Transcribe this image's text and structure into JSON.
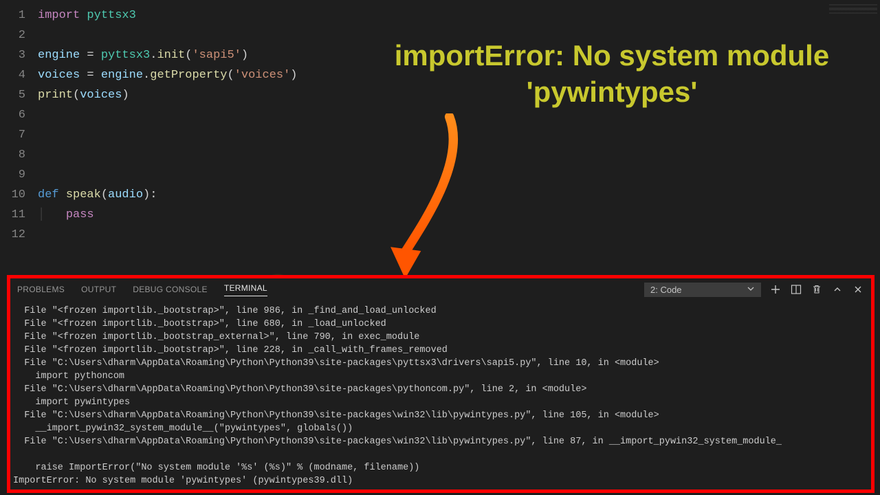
{
  "code": {
    "lines": [
      {
        "n": "1",
        "html": "<span class='kw'>import</span> <span class='mod'>pyttsx3</span>"
      },
      {
        "n": "2",
        "html": ""
      },
      {
        "n": "3",
        "html": "<span class='var'>engine</span> = <span class='mod'>pyttsx3</span>.<span class='fn'>init</span>(<span class='str'>'sapi5'</span>)"
      },
      {
        "n": "4",
        "html": "<span class='var'>voices</span> = <span class='var'>engine</span>.<span class='fn'>getProperty</span>(<span class='str'>'voices'</span>)"
      },
      {
        "n": "5",
        "html": "<span class='fn'>print</span>(<span class='var'>voices</span>)"
      },
      {
        "n": "6",
        "html": ""
      },
      {
        "n": "7",
        "html": ""
      },
      {
        "n": "8",
        "html": ""
      },
      {
        "n": "9",
        "html": ""
      },
      {
        "n": "10",
        "html": "<span class='defn'>def</span> <span class='fn'>speak</span>(<span class='param'>audio</span>):"
      },
      {
        "n": "11",
        "html": "<span class='indent-guide'>│</span>   <span class='kw'>pass</span>"
      },
      {
        "n": "12",
        "html": ""
      }
    ]
  },
  "annotation": {
    "line1": "importError: No system module",
    "line2": "'pywintypes'"
  },
  "panel": {
    "tabs": {
      "problems": "PROBLEMS",
      "output": "OUTPUT",
      "debug": "DEBUG CONSOLE",
      "terminal": "TERMINAL"
    },
    "selector": "2: Code"
  },
  "terminal": {
    "lines": [
      "  File \"<frozen importlib._bootstrap>\", line 986, in _find_and_load_unlocked",
      "  File \"<frozen importlib._bootstrap>\", line 680, in _load_unlocked",
      "  File \"<frozen importlib._bootstrap_external>\", line 790, in exec_module",
      "  File \"<frozen importlib._bootstrap>\", line 228, in _call_with_frames_removed",
      "  File \"C:\\Users\\dharm\\AppData\\Roaming\\Python\\Python39\\site-packages\\pyttsx3\\drivers\\sapi5.py\", line 10, in <module>",
      "    import pythoncom",
      "  File \"C:\\Users\\dharm\\AppData\\Roaming\\Python\\Python39\\site-packages\\pythoncom.py\", line 2, in <module>",
      "    import pywintypes",
      "  File \"C:\\Users\\dharm\\AppData\\Roaming\\Python\\Python39\\site-packages\\win32\\lib\\pywintypes.py\", line 105, in <module>",
      "    __import_pywin32_system_module__(\"pywintypes\", globals())",
      "  File \"C:\\Users\\dharm\\AppData\\Roaming\\Python\\Python39\\site-packages\\win32\\lib\\pywintypes.py\", line 87, in __import_pywin32_system_module_",
      "",
      "    raise ImportError(\"No system module '%s' (%s)\" % (modname, filename))",
      "ImportError: No system module 'pywintypes' (pywintypes39.dll)"
    ]
  }
}
